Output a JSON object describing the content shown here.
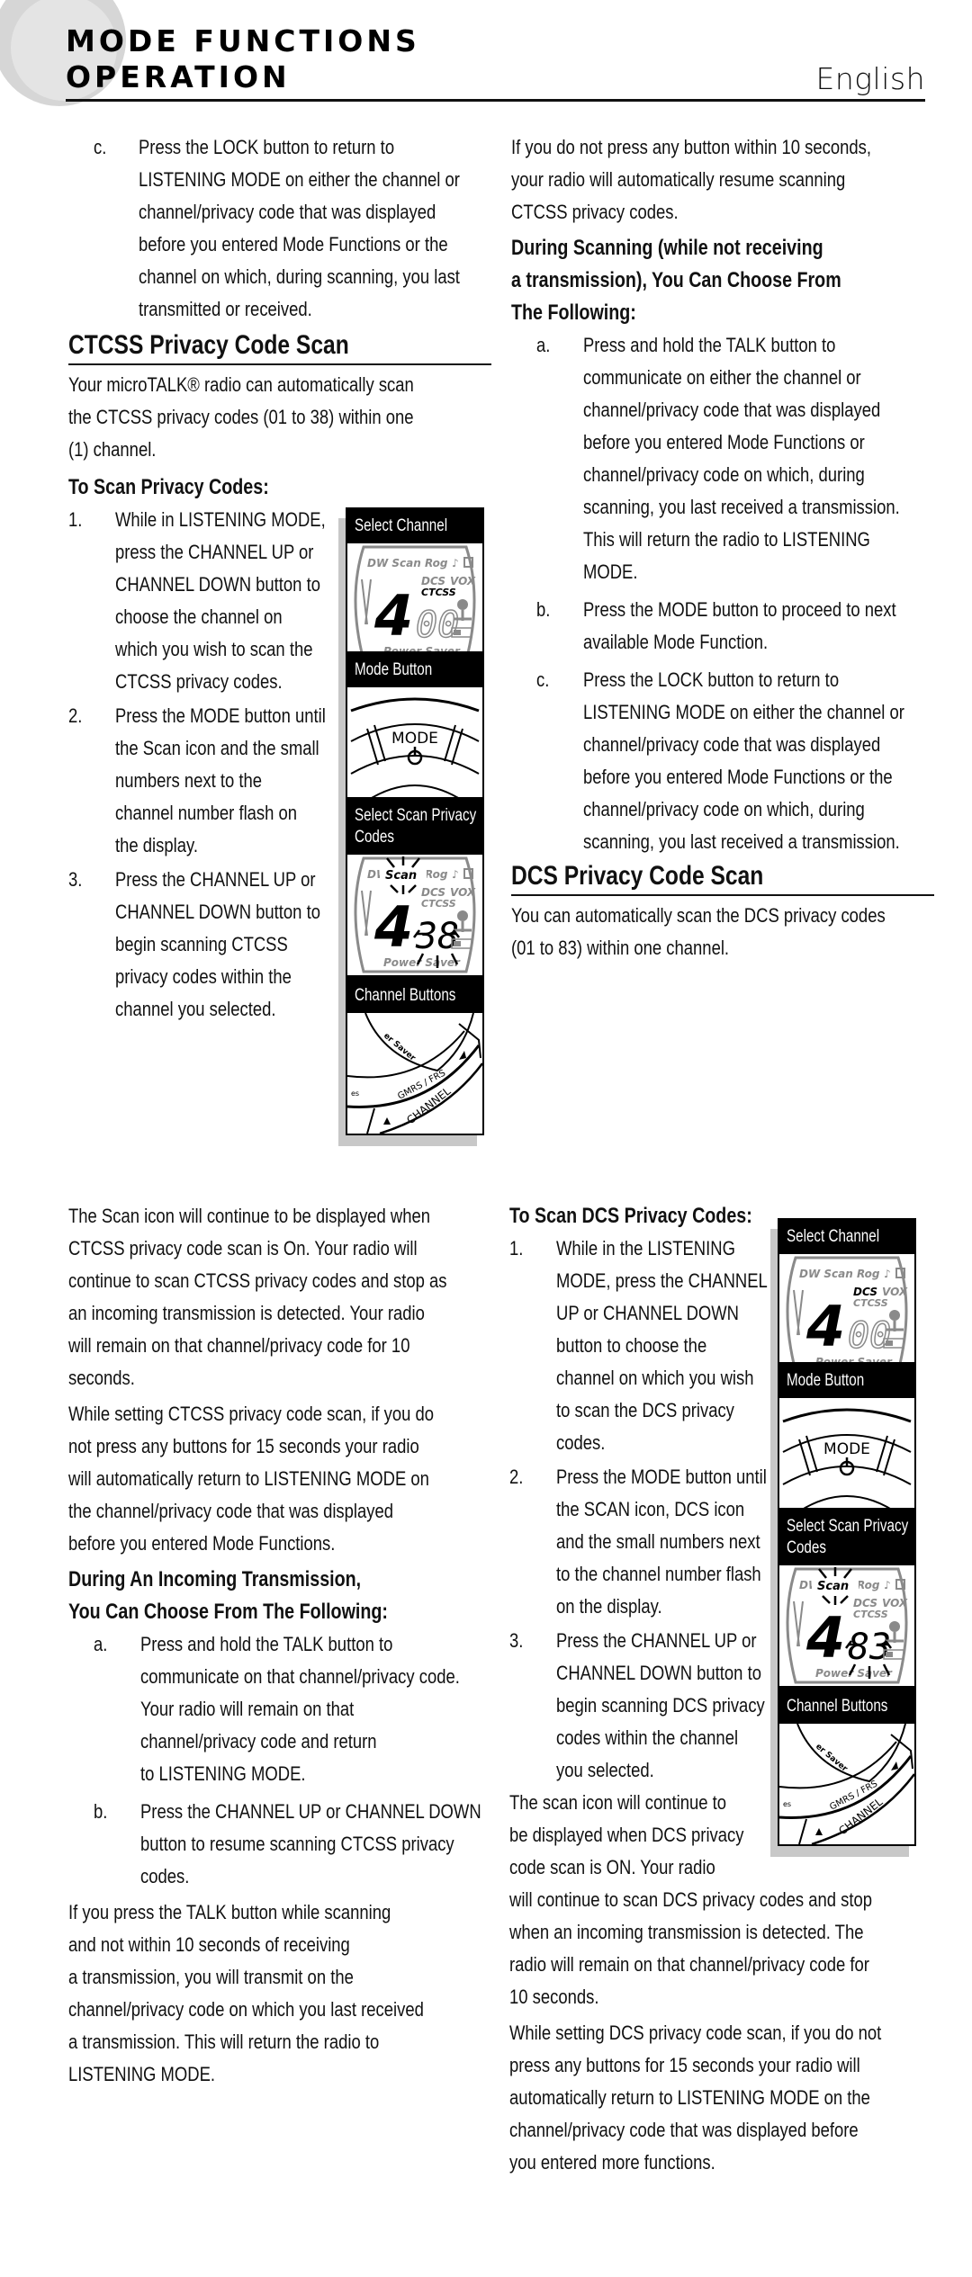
{
  "header": {
    "title_line1": "MODE FUNCTIONS",
    "title_line2": "OPERATION",
    "language": "English"
  },
  "left_top": {
    "item_c_label": "c.",
    "item_c_lines": [
      "Press the LOCK button to return to",
      "LISTENING MODE on either the channel or",
      "channel/privacy code that was displayed",
      "before you entered Mode Functions or the",
      "channel on which, during scanning, you last",
      "transmitted or received."
    ],
    "ctcss_heading": "CTCSS Privacy Code Scan",
    "ctcss_intro": [
      "Your microTALK® radio can automatically scan",
      "the CTCSS privacy codes (01 to 38) within one",
      "(1) channel."
    ],
    "scan_heading": "To Scan Privacy Codes:",
    "steps": [
      {
        "label": "1.",
        "lines": [
          "While in LISTENING MODE,",
          "press the CHANNEL UP or",
          "CHANNEL DOWN button to",
          "choose the channel on",
          "which you wish to scan the",
          "CTCSS privacy codes."
        ]
      },
      {
        "label": "2.",
        "lines": [
          "Press the MODE button until",
          "the Scan icon and the small",
          "numbers next to the",
          "channel number flash on",
          "the display."
        ]
      },
      {
        "label": "3.",
        "lines": [
          "Press the CHANNEL UP or",
          "CHANNEL DOWN button to",
          "begin scanning CTCSS",
          "privacy codes within the",
          "channel you selected."
        ]
      }
    ]
  },
  "right_top": {
    "intro": [
      "If you do not press any button within 10 seconds,",
      "your radio will automatically resume scanning",
      "CTCSS privacy codes."
    ],
    "during_heading": [
      "During Scanning (while not receiving",
      "a transmission), You Can Choose From",
      "The Following:"
    ],
    "options": [
      {
        "label": "a.",
        "lines": [
          "Press and hold the TALK button to",
          "communicate on either the channel or",
          "channel/privacy code that was displayed",
          "before you entered Mode Functions or",
          "channel/privacy code on which, during",
          "scanning, you last received a transmission.",
          "This will return the radio to LISTENING",
          "MODE."
        ]
      },
      {
        "label": "b.",
        "lines": [
          "Press the MODE button to proceed to next",
          "available Mode Function."
        ]
      },
      {
        "label": "c.",
        "lines": [
          "Press the LOCK button to return to",
          "LISTENING MODE on either the channel or",
          "channel/privacy code that was displayed",
          "before you entered Mode Functions or the",
          "channel/privacy code on which, during",
          "scanning, you last received a transmission."
        ]
      }
    ],
    "dcs_heading": "DCS Privacy Code Scan",
    "dcs_intro": [
      "You can automatically scan the DCS privacy codes",
      "(01 to 83) within one channel."
    ]
  },
  "figures_ctcss": [
    {
      "caption": [
        "Select Channel"
      ],
      "type": "lcd",
      "channel": "4",
      "code": "00",
      "highlight": "CTCSS"
    },
    {
      "caption": [
        "Mode Button"
      ],
      "type": "mode",
      "button_label": "MODE"
    },
    {
      "caption": [
        "Select Scan Privacy",
        "Codes"
      ],
      "type": "lcd-scan",
      "channel": "4",
      "code": "38",
      "highlight": "Scan"
    },
    {
      "caption": [
        "Channel Buttons"
      ],
      "type": "channel",
      "labels": [
        "GMRS / FRS",
        "CHANNEL"
      ]
    }
  ],
  "figures_dcs": [
    {
      "caption": [
        "Select Channel"
      ],
      "type": "lcd",
      "channel": "4",
      "code": "00",
      "highlight": "DCS"
    },
    {
      "caption": [
        "Mode Button"
      ],
      "type": "mode",
      "button_label": "MODE"
    },
    {
      "caption": [
        "Select Scan Privacy",
        "Codes"
      ],
      "type": "lcd-scan",
      "channel": "4",
      "code": "83",
      "highlight": "Scan"
    },
    {
      "caption": [
        "Channel Buttons"
      ],
      "type": "channel",
      "labels": [
        "GMRS / FRS",
        "CHANNEL"
      ]
    }
  ],
  "lcd_labels": {
    "top": "DW Scan Rog",
    "dcs": "DCS",
    "vox": "VOX",
    "ctcss": "CTCSS",
    "bottom": "Power Saver"
  },
  "left_bottom": {
    "para1": [
      "The Scan icon will continue to be displayed when",
      "CTCSS privacy code scan is On. Your radio will",
      "continue to scan CTCSS privacy codes and stop as",
      "an incoming transmission is detected. Your radio",
      "will remain on that channel/privacy code for 10",
      "seconds."
    ],
    "para2": [
      "While setting CTCSS privacy code scan, if you do",
      "not press any buttons for 15 seconds your radio",
      "will automatically return to LISTENING MODE on",
      "the channel/privacy code that was displayed",
      "before you entered Mode Functions."
    ],
    "incoming_heading": [
      "During An Incoming Transmission,",
      "You Can Choose From The Following:"
    ],
    "options": [
      {
        "label": "a.",
        "lines": [
          "Press and hold the TALK button to",
          "communicate on that channel/privacy code.",
          "Your radio will remain on that",
          "channel/privacy code and return",
          "to LISTENING MODE."
        ]
      },
      {
        "label": "b.",
        "lines": [
          "Press the CHANNEL UP or CHANNEL DOWN",
          "button to resume scanning CTCSS privacy",
          "codes."
        ]
      }
    ],
    "para3": [
      "If you press the TALK button while scanning",
      "and not within 10 seconds of receiving",
      "a transmission, you will transmit on the",
      "channel/privacy code on which you last received",
      "a transmission. This will return the radio to",
      "LISTENING MODE."
    ]
  },
  "right_bottom": {
    "heading": "To Scan DCS Privacy Codes:",
    "steps": [
      {
        "label": "1.",
        "lines": [
          "While in the LISTENING",
          "MODE, press the CHANNEL",
          "UP or CHANNEL DOWN",
          "button to choose the",
          "channel on which you wish",
          "to scan the DCS privacy",
          "codes."
        ]
      },
      {
        "label": "2.",
        "lines": [
          "Press the MODE button until",
          "the SCAN icon, DCS icon",
          "and the small numbers next",
          "to the channel number flash",
          "on the display."
        ]
      },
      {
        "label": "3.",
        "lines": [
          "Press the CHANNEL UP or",
          "CHANNEL DOWN button to",
          "begin scanning DCS privacy",
          "codes within the channel",
          "you selected."
        ]
      }
    ],
    "para1": [
      "The scan icon will continue to",
      "be displayed when DCS privacy",
      "code scan is ON. Your radio",
      "will continue to scan DCS privacy codes and stop",
      "when an incoming transmission is detected. The",
      "radio will remain on that channel/privacy code for",
      "10 seconds."
    ],
    "para2": [
      "While setting DCS privacy code scan, if you do not",
      "press any buttons for 15 seconds your radio will",
      "automatically return to LISTENING MODE on the",
      "channel/privacy code that was displayed before",
      "you entered more functions."
    ]
  }
}
